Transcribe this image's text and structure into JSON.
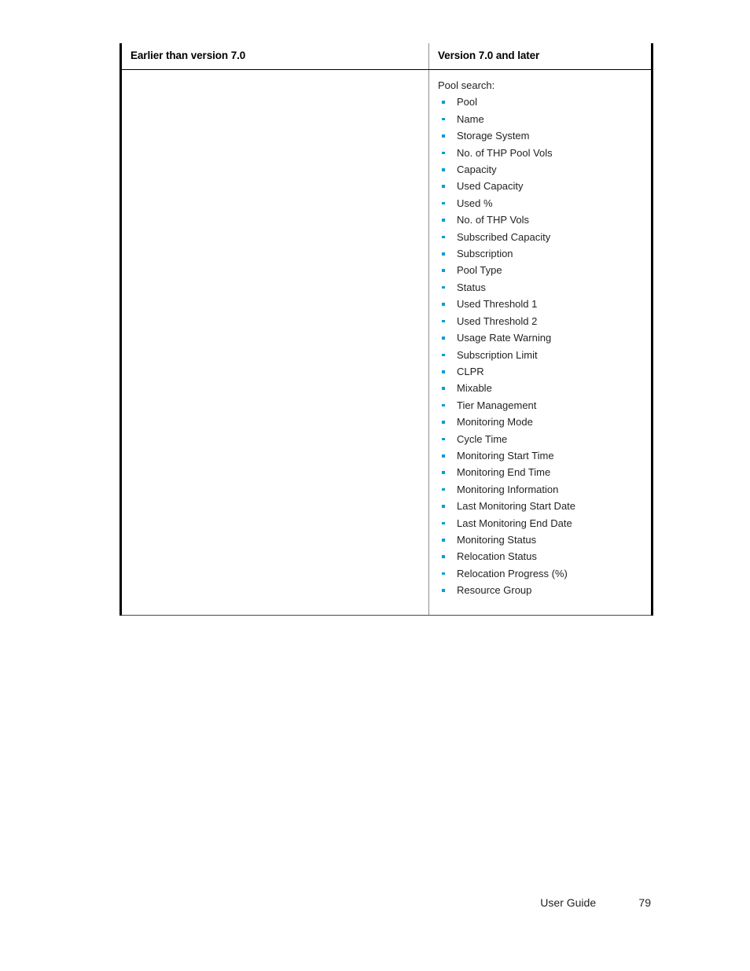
{
  "document": {
    "table": {
      "columns": [
        {
          "header": "Earlier than version 7.0"
        },
        {
          "header": "Version 7.0 and later"
        }
      ],
      "rows": [
        {
          "left": {
            "intro": "",
            "items": []
          },
          "right": {
            "intro": "Pool search:",
            "items": [
              "Pool",
              "Name",
              "Storage System",
              "No. of THP Pool Vols",
              "Capacity",
              "Used Capacity",
              "Used %",
              "No. of THP Vols",
              "Subscribed Capacity",
              "Subscription",
              "Pool Type",
              "Status",
              "Used Threshold 1",
              "Used Threshold 2",
              "Usage Rate Warning",
              "Subscription Limit",
              "CLPR",
              "Mixable",
              "Tier Management",
              "Monitoring Mode",
              "Cycle Time",
              "Monitoring Start Time",
              "Monitoring End Time",
              "Monitoring Information",
              "Last Monitoring Start Date",
              "Last Monitoring End Date",
              "Monitoring Status",
              "Relocation Status",
              "Relocation Progress (%)",
              "Resource Group"
            ]
          }
        }
      ]
    },
    "footer": {
      "label": "User Guide",
      "page_number": "79"
    },
    "colors": {
      "bullet": "#0a9bd7",
      "text": "#231f20",
      "rule": "#000000"
    }
  }
}
